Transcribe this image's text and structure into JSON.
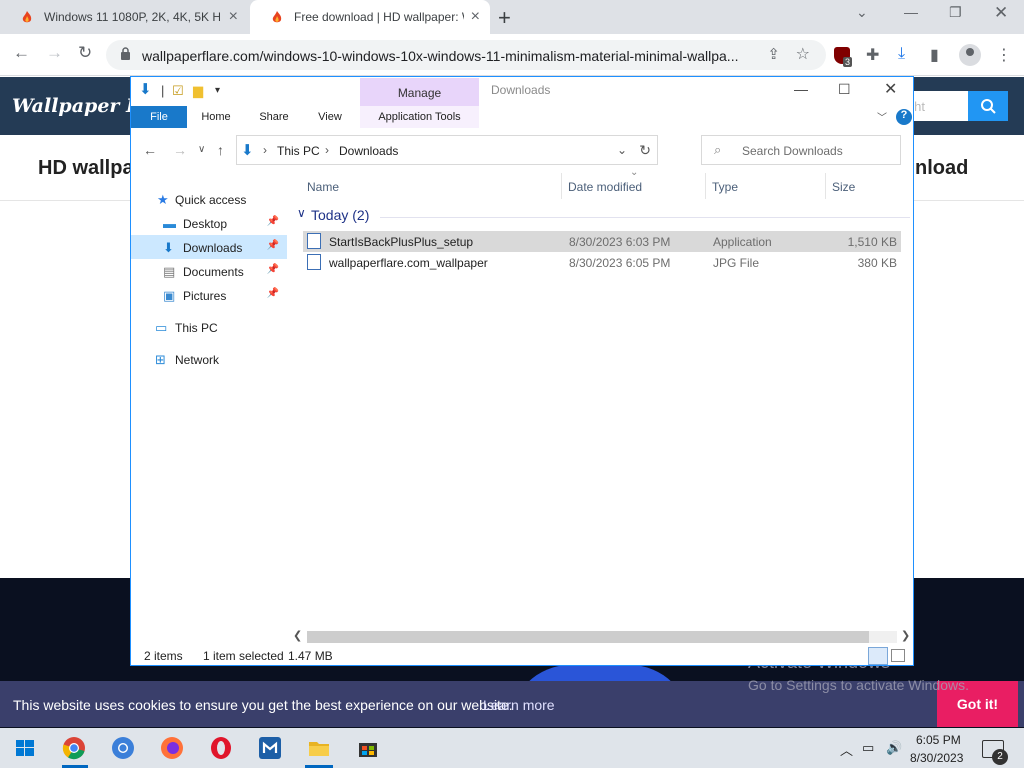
{
  "browser": {
    "tabs": [
      {
        "title": "Windows 11 1080P, 2K, 4K, 5K HD"
      },
      {
        "title": "Free download | HD wallpaper: W"
      }
    ],
    "url": "wallpaperflare.com/windows-10-windows-10x-windows-11-minimalism-material-minimal-wallpa...",
    "ublock_count": "3"
  },
  "site": {
    "logo": "Wallpaper Flar",
    "search_placeholder": "ight",
    "heading_left": "HD wallpa",
    "heading_right": "nload",
    "cookie_text": "This website uses cookies to ensure you get the best experience on our website.",
    "cookie_learn": "Learn more",
    "cookie_button": "Got it!",
    "activate_title": "Activate Windows",
    "activate_sub": "Go to Settings to activate Windows."
  },
  "explorer": {
    "context_tab": "Manage",
    "window_title": "Downloads",
    "ribbon_tabs": [
      "File",
      "Home",
      "Share",
      "View",
      "Application Tools"
    ],
    "breadcrumb": [
      "This PC",
      "Downloads"
    ],
    "search_placeholder": "Search Downloads",
    "nav": [
      {
        "label": "Quick access"
      },
      {
        "label": "Desktop"
      },
      {
        "label": "Downloads"
      },
      {
        "label": "Documents"
      },
      {
        "label": "Pictures"
      },
      {
        "label": "This PC"
      },
      {
        "label": "Network"
      }
    ],
    "columns": [
      "Name",
      "Date modified",
      "Type",
      "Size"
    ],
    "group": "Today (2)",
    "files": [
      {
        "name": "StartIsBackPlusPlus_setup",
        "date": "8/30/2023 6:03 PM",
        "type": "Application",
        "size": "1,510 KB"
      },
      {
        "name": "wallpaperflare.com_wallpaper",
        "date": "8/30/2023 6:05 PM",
        "type": "JPG File",
        "size": "380 KB"
      }
    ],
    "status": {
      "count": "2 items",
      "selected": "1 item selected",
      "size": "1.47 MB"
    }
  },
  "taskbar": {
    "time": "6:05 PM",
    "date": "8/30/2023",
    "notifications": "2"
  }
}
